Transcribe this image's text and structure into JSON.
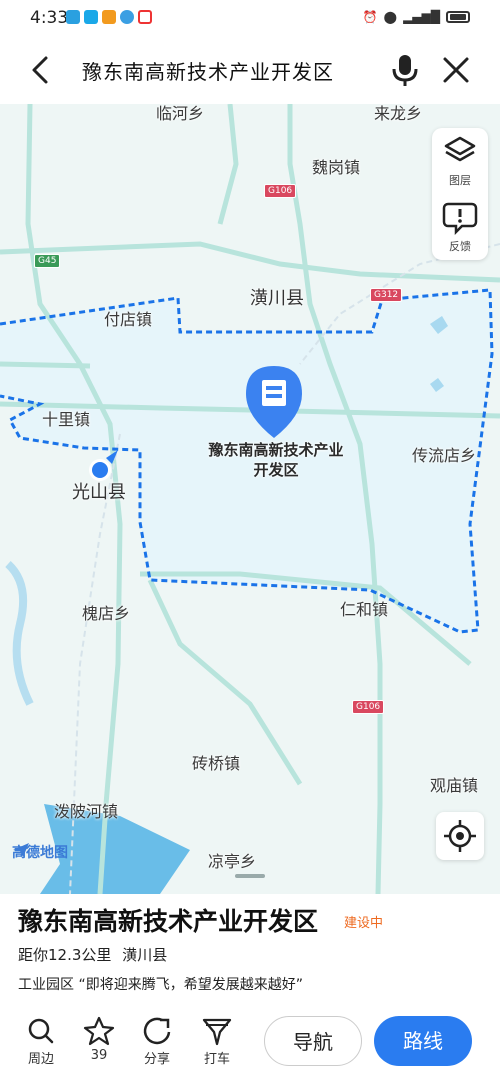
{
  "status": {
    "time": "4:33"
  },
  "search": {
    "title": "豫东南高新技术产业开发区"
  },
  "map": {
    "labels": {
      "linhe": "临河乡",
      "laifeng": "来龙乡",
      "weigang": "魏岗镇",
      "huangchuan": "潢川县",
      "fudian": "付店镇",
      "shili": "十里镇",
      "guangshan": "光山县",
      "chuanliu": "传流店乡",
      "huaidian": "槐店乡",
      "renhe": "仁和镇",
      "zhuanqiao": "砖桥镇",
      "guanmiao": "观庙镇",
      "pohe": "泼陂河镇",
      "liangting": "凉亭乡"
    },
    "roads": {
      "g106_top": "G106",
      "g45": "G45",
      "g312": "G312",
      "g106_bottom": "G106"
    },
    "poi_title": "豫东南高新技术产业开发区",
    "tools": {
      "layers": "图层",
      "feedback": "反馈"
    },
    "brand": "高德地图",
    "colors": {
      "boundary": "#1a73e8",
      "region_fill": "#e8f6fb",
      "road": "#b8e4dc",
      "accent": "#2a7cf0"
    }
  },
  "place": {
    "name": "豫东南高新技术产业开发区",
    "status": "建设中",
    "distance": "距你12.3公里",
    "county": "潢川县",
    "category": "工业园区 “即将迎来腾飞，希望发展越来越好”"
  },
  "actions": {
    "nearby": "周边",
    "favorite_count": "39",
    "share": "分享",
    "taxi": "打车",
    "navigate": "导航",
    "route": "路线"
  }
}
